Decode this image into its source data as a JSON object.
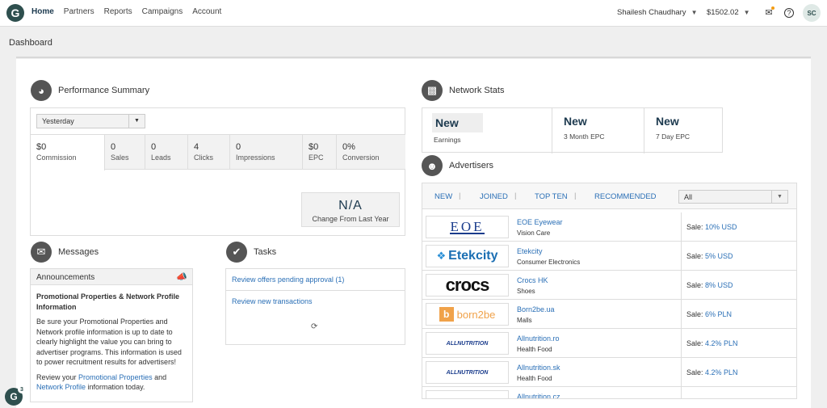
{
  "nav": {
    "logo": "G",
    "items": [
      "Home",
      "Partners",
      "Reports",
      "Campaigns",
      "Account"
    ],
    "active": "Home"
  },
  "header": {
    "user_name": "Shailesh Chaudhary",
    "balance": "$1502.02",
    "avatar_initials": "SC"
  },
  "page": {
    "title": "Dashboard"
  },
  "performance": {
    "title": "Performance Summary",
    "period": "Yesterday",
    "metrics": [
      {
        "value": "$0",
        "label": "Commission"
      },
      {
        "value": "0",
        "label": "Sales"
      },
      {
        "value": "0",
        "label": "Leads"
      },
      {
        "value": "4",
        "label": "Clicks"
      },
      {
        "value": "0",
        "label": "Impressions"
      },
      {
        "value": "$0",
        "label": "EPC"
      },
      {
        "value": "0%",
        "label": "Conversion"
      }
    ],
    "change_value": "N/A",
    "change_label": "Change From Last Year"
  },
  "messages": {
    "title": "Messages",
    "header": "Announcements",
    "heading": "Promotional Properties & Network Profile Information",
    "body": "Be sure your Promotional Properties and Network profile information is up to date to clearly highlight the value you can bring to advertiser programs. This information is used to power recruitment results for advertisers!",
    "review_prefix": "Review your ",
    "link1": "Promotional Properties",
    "and": " and ",
    "link2": "Network Profile",
    "suffix": " information today."
  },
  "tasks": {
    "title": "Tasks",
    "items": [
      "Review offers pending approval (1)",
      "Review new transactions"
    ]
  },
  "network_stats": {
    "title": "Network Stats",
    "stats": [
      {
        "value": "New",
        "label": "Earnings"
      },
      {
        "value": "New",
        "label": "3 Month EPC"
      },
      {
        "value": "New",
        "label": "7 Day EPC"
      }
    ]
  },
  "advertisers": {
    "title": "Advertisers",
    "tabs": [
      "NEW",
      "JOINED",
      "TOP TEN",
      "RECOMMENDED"
    ],
    "filter": "All",
    "rows": [
      {
        "logo": "EOE",
        "name": "EOE Eyewear",
        "category": "Vision Care",
        "sale_prefix": "Sale: ",
        "sale": "10% USD"
      },
      {
        "logo": "Etekcity",
        "name": "Etekcity",
        "category": "Consumer Electronics",
        "sale_prefix": "Sale: ",
        "sale": "5% USD"
      },
      {
        "logo": "crocs",
        "name": "Crocs HK",
        "category": "Shoes",
        "sale_prefix": "Sale: ",
        "sale": "8% USD"
      },
      {
        "logo": "born2be",
        "name": "Born2be.ua",
        "category": "Malls",
        "sale_prefix": "Sale: ",
        "sale": "6% PLN"
      },
      {
        "logo": "ALLNUTRITION",
        "name": "Allnutrition.ro",
        "category": "Health Food",
        "sale_prefix": "Sale: ",
        "sale": "4.2% PLN"
      },
      {
        "logo": "ALLNUTRITION",
        "name": "Allnutrition.sk",
        "category": "Health Food",
        "sale_prefix": "Sale: ",
        "sale": "4.2% PLN"
      },
      {
        "logo": "",
        "name": "Allnutrition.cz",
        "category": "",
        "sale_prefix": "",
        "sale": ""
      }
    ]
  },
  "chat_badge": {
    "count": "3"
  },
  "colors": {
    "brand": "#2e4f4e",
    "link": "#2a6fb6",
    "heading": "#1d3a4f"
  }
}
